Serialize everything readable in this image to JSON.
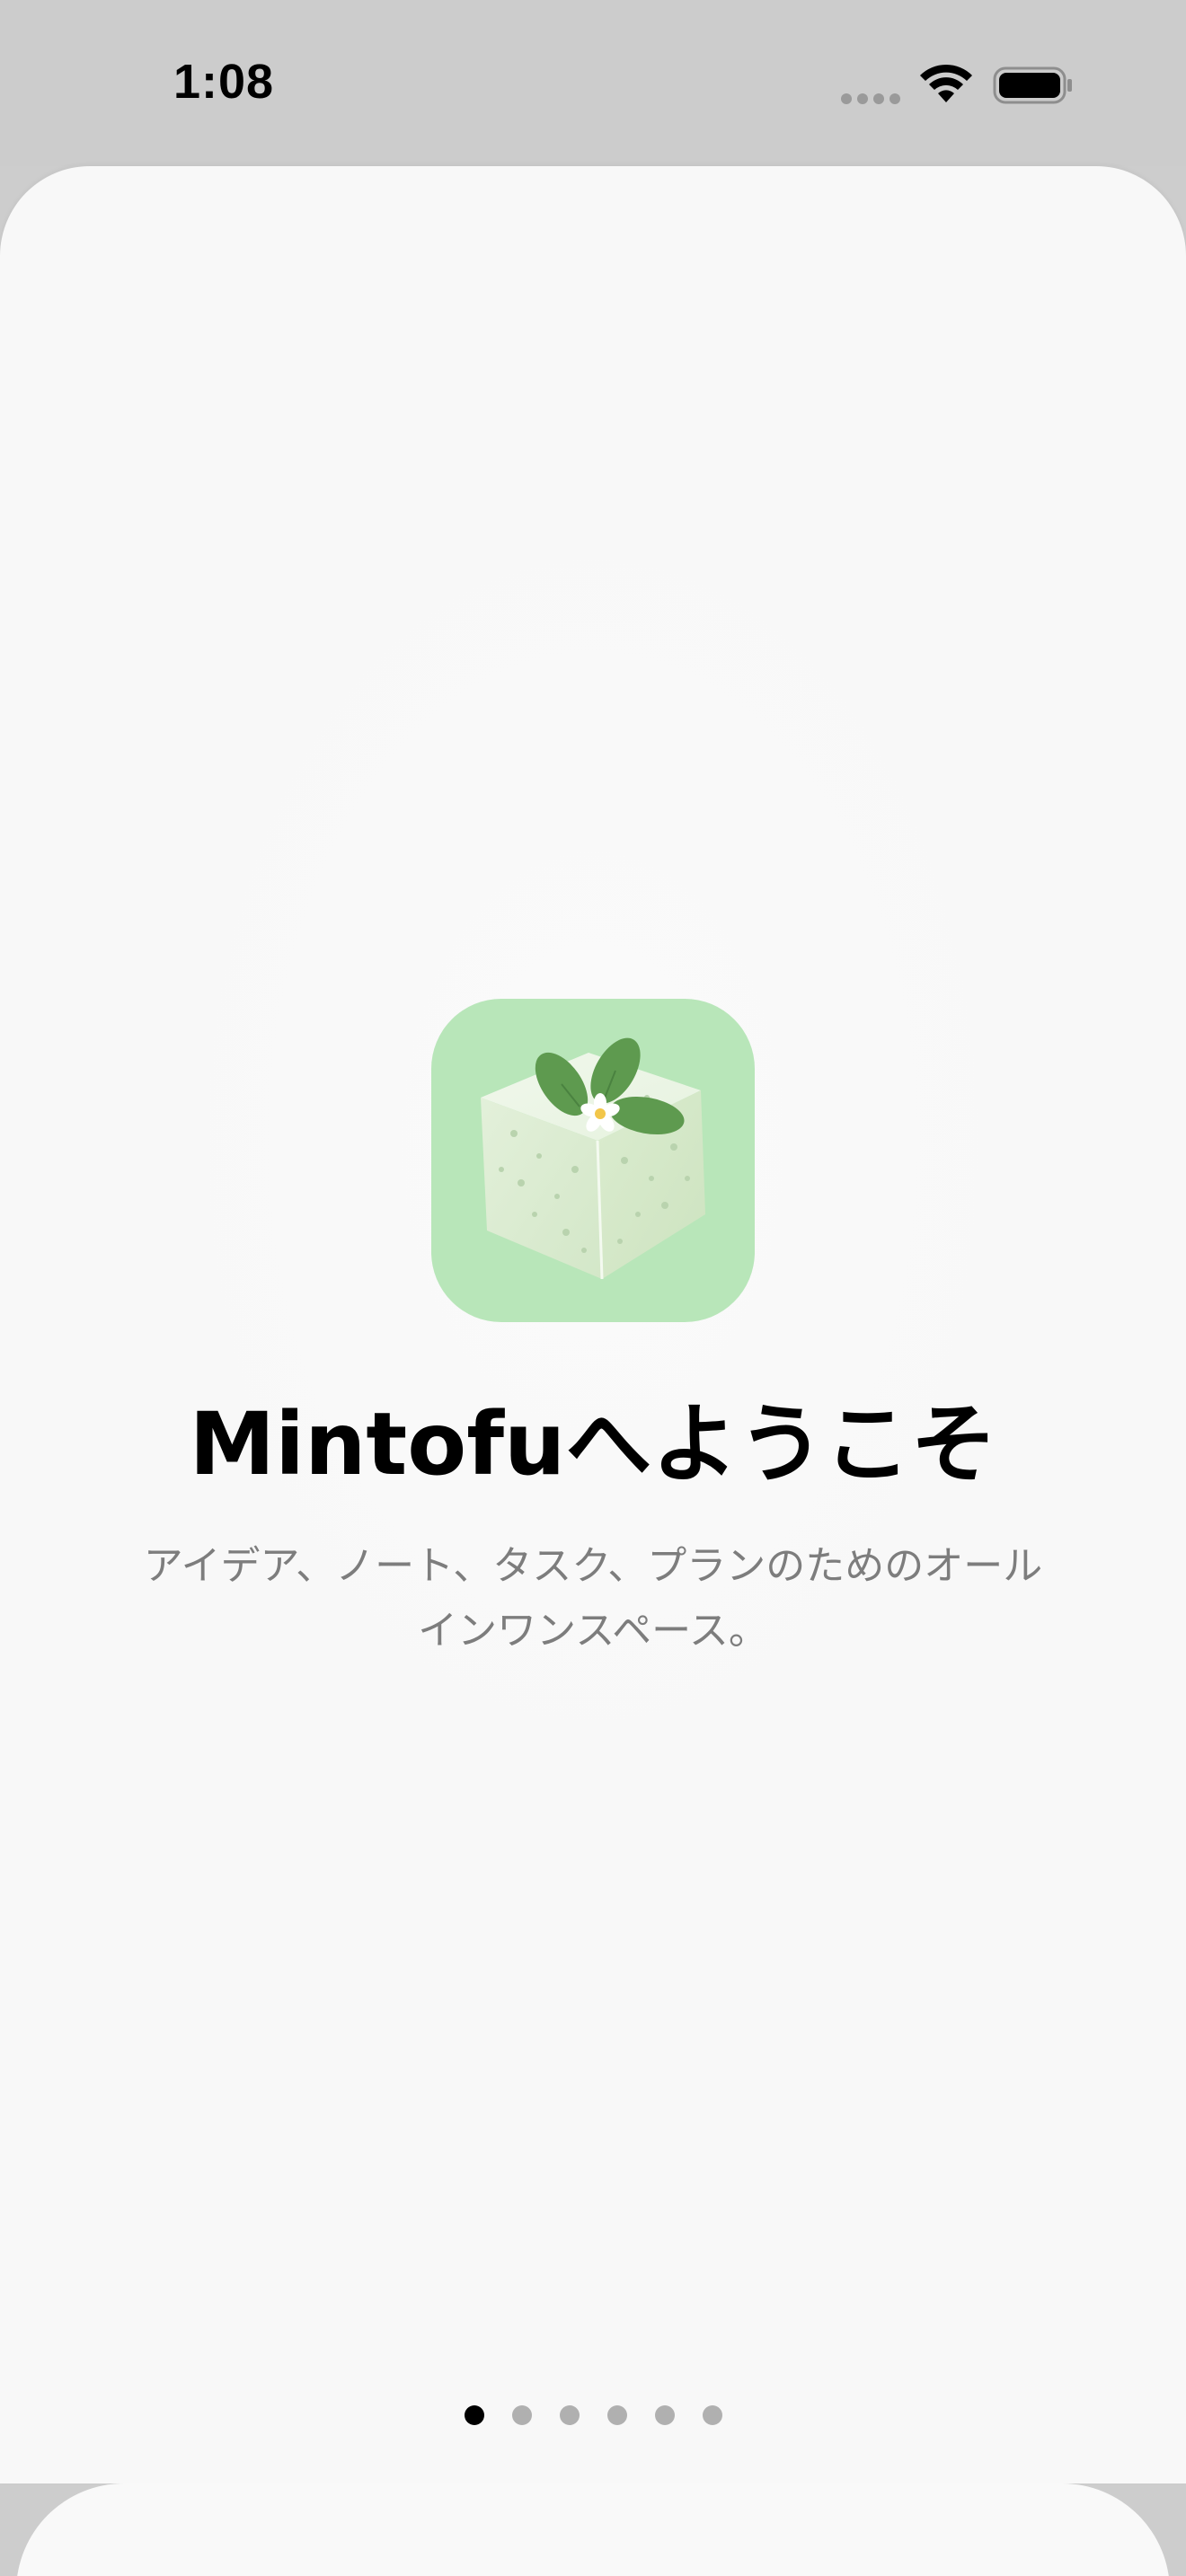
{
  "status_bar": {
    "time": "1:08"
  },
  "onboarding": {
    "title": "Mintofuへようこそ",
    "subtitle_line1": "アイデア、ノート、タスク、プランのためのオール",
    "subtitle_line2": "インワンスペース。",
    "page_count": 6,
    "current_page": 1
  },
  "colors": {
    "icon_background": "#b8e6b9",
    "leaf": "#5e9a4f",
    "active_dot": "#000000",
    "inactive_dot": "#b0b0b0",
    "subtitle": "#7d7d7d"
  },
  "icons": {
    "app_icon": "tofu-cube-with-mint-leaves",
    "wifi": "wifi-icon",
    "battery": "battery-icon",
    "cellular": "cellular-dots-icon"
  }
}
